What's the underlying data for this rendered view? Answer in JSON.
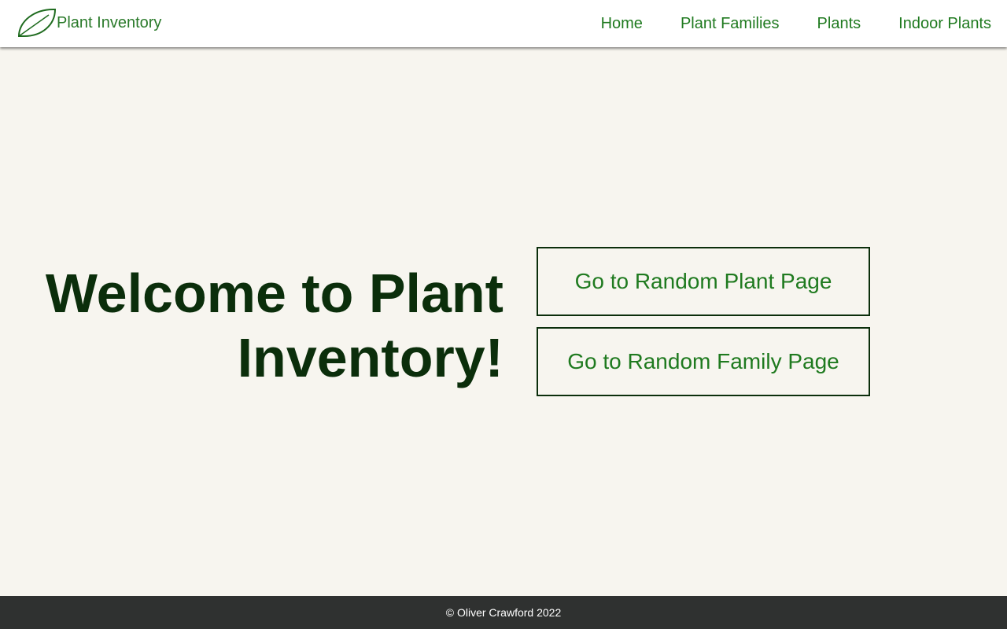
{
  "brand": {
    "name": "Plant Inventory",
    "icon": "leaf-icon"
  },
  "nav": {
    "items": [
      {
        "label": "Home"
      },
      {
        "label": "Plant Families"
      },
      {
        "label": "Plants"
      },
      {
        "label": "Indoor Plants"
      }
    ]
  },
  "hero": {
    "heading_line1": "Welcome to Plant",
    "heading_line2": "Inventory!"
  },
  "actions": {
    "random_plant_label": "Go to Random Plant Page",
    "random_family_label": "Go to Random Family Page"
  },
  "footer": {
    "text": "© Oliver Crawford 2022"
  },
  "colors": {
    "background": "#f7f5ef",
    "brand_green": "#1f7a1f",
    "heading_green": "#0b2e0b",
    "footer_bg": "#2f3130"
  }
}
